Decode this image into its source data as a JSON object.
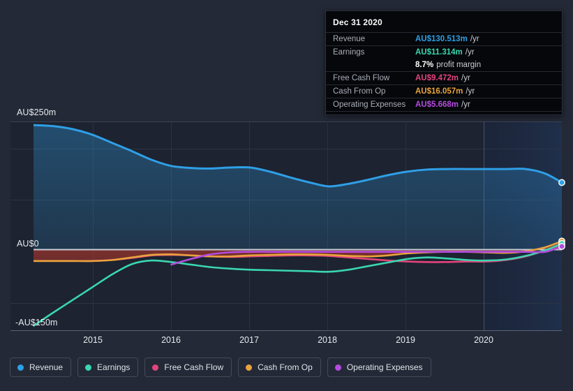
{
  "tooltip": {
    "title": "Dec 31 2020",
    "rows": [
      {
        "key": "Revenue",
        "value": "AU$130.513m",
        "suffix": "/yr",
        "color": "#2f9fe6"
      },
      {
        "key": "Earnings",
        "value": "AU$11.314m",
        "suffix": "/yr",
        "color": "#3ad6b0"
      },
      {
        "key": "",
        "value": "8.7%",
        "suffix": "profit margin",
        "color": "#ffffff"
      },
      {
        "key": "Free Cash Flow",
        "value": "AU$9.472m",
        "suffix": "/yr",
        "color": "#e2447c"
      },
      {
        "key": "Cash From Op",
        "value": "AU$16.057m",
        "suffix": "/yr",
        "color": "#e8a33d"
      },
      {
        "key": "Operating Expenses",
        "value": "AU$5.668m",
        "suffix": "/yr",
        "color": "#b44ce0"
      }
    ]
  },
  "legend": {
    "items": [
      {
        "label": "Revenue",
        "color": "#2f9fe6"
      },
      {
        "label": "Earnings",
        "color": "#3ad6b0"
      },
      {
        "label": "Free Cash Flow",
        "color": "#e2447c"
      },
      {
        "label": "Cash From Op",
        "color": "#e8a33d"
      },
      {
        "label": "Operating Expenses",
        "color": "#b44ce0"
      }
    ]
  },
  "chart_data": {
    "type": "line",
    "title": "",
    "xlabel": "",
    "ylabel": "",
    "currency": "AU$",
    "grid": true,
    "legend_position": "bottom",
    "ylim": [
      -150,
      250
    ],
    "y_ticks": [
      250,
      0,
      -150
    ],
    "y_tick_labels": [
      "AU$250m",
      "AU$0",
      "-AU$150m"
    ],
    "x_tick_labels": [
      "2015",
      "2016",
      "2017",
      "2018",
      "2019",
      "2020"
    ],
    "x": [
      2014.25,
      2014.5,
      2014.75,
      2015,
      2015.25,
      2015.5,
      2015.75,
      2016,
      2016.25,
      2016.5,
      2016.75,
      2017,
      2017.25,
      2017.5,
      2017.75,
      2018,
      2018.25,
      2018.5,
      2018.75,
      2019,
      2019.25,
      2019.5,
      2019.75,
      2020,
      2020.25,
      2020.5,
      2020.75,
      2020.96
    ],
    "series": [
      {
        "name": "Revenue",
        "color": "#2f9fe6",
        "values": [
          243,
          241,
          235,
          224,
          208,
          192,
          175,
          163,
          159,
          158,
          160,
          160,
          152,
          141,
          131,
          123,
          128,
          136,
          145,
          152,
          156,
          157,
          157,
          157,
          157,
          157,
          148,
          130.513
        ]
      },
      {
        "name": "Earnings",
        "color": "#3ad6b0",
        "values": [
          -150,
          -124,
          -99,
          -74,
          -49,
          -29,
          -22,
          -25,
          -30,
          -35,
          -38,
          -40,
          -41,
          -42,
          -43,
          -44,
          -40,
          -33,
          -26,
          -19,
          -16,
          -18,
          -21,
          -22,
          -20,
          -13,
          -2,
          11.314
        ]
      },
      {
        "name": "Free Cash Flow",
        "color": "#e2447c",
        "values": [
          -23,
          -23,
          -23,
          -23,
          -21,
          -17,
          -12,
          -11,
          -12,
          -14,
          -15,
          -14,
          -13,
          -12,
          -12,
          -13,
          -16,
          -19,
          -22,
          -24,
          -25,
          -25,
          -24,
          -24,
          -21,
          -14,
          -2,
          9.472
        ]
      },
      {
        "name": "Cash From Op",
        "color": "#e8a33d",
        "values": [
          -23,
          -23,
          -23,
          -23,
          -21,
          -16,
          -11,
          -10,
          -12,
          -14,
          -14,
          -12,
          -11,
          -10,
          -10,
          -11,
          -13,
          -14,
          -12,
          -8,
          -6,
          -5,
          -5,
          -6,
          -7,
          -4,
          4,
          16.057
        ]
      },
      {
        "name": "Operating Expenses",
        "color": "#b44ce0",
        "values": [
          null,
          null,
          null,
          null,
          null,
          null,
          null,
          -30,
          -19,
          -10,
          -6,
          -5,
          -5,
          -5,
          -5,
          -5,
          -5,
          -5,
          -5,
          -5,
          -5,
          -5,
          -5,
          -5,
          -5,
          -5,
          -5,
          5.668
        ]
      }
    ]
  }
}
